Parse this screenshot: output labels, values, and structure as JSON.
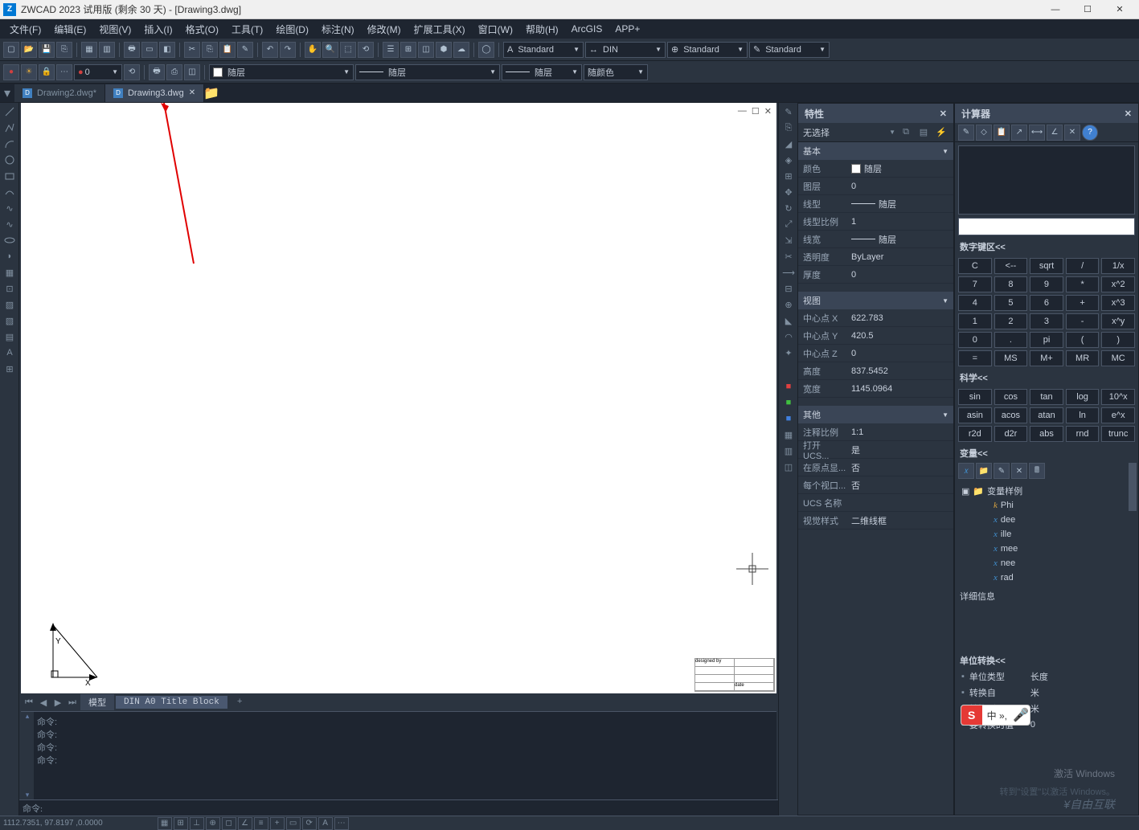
{
  "title": "ZWCAD 2023 试用版 (剩余 30 天) - [Drawing3.dwg]",
  "menus": [
    "文件(F)",
    "编辑(E)",
    "视图(V)",
    "插入(I)",
    "格式(O)",
    "工具(T)",
    "绘图(D)",
    "标注(N)",
    "修改(M)",
    "扩展工具(X)",
    "窗口(W)",
    "帮助(H)",
    "ArcGIS",
    "APP+"
  ],
  "toolbar1": {
    "layer_value": "0",
    "style_boxes": [
      {
        "icon": "A",
        "value": "Standard"
      },
      {
        "icon": "↔",
        "value": "DIN"
      },
      {
        "icon": "⊕",
        "value": "Standard"
      },
      {
        "icon": "✎",
        "value": "Standard"
      }
    ]
  },
  "toolbar2": {
    "combos": [
      "随层",
      "随层",
      "随层",
      "随颜色"
    ]
  },
  "doctabs": [
    {
      "name": "Drawing2.dwg*",
      "active": false
    },
    {
      "name": "Drawing3.dwg",
      "active": true
    }
  ],
  "layout_tabs": [
    "模型",
    "DIN A0 Title Block",
    "+"
  ],
  "command": {
    "history": [
      "命令:",
      "命令:",
      "命令:",
      "命令:"
    ],
    "prompt": "命令:"
  },
  "properties": {
    "title": "特性",
    "selector": "无选择",
    "sections": {
      "basic": {
        "title": "基本",
        "rows": [
          {
            "label": "颜色",
            "value": "随层",
            "swatch": true
          },
          {
            "label": "图层",
            "value": "0"
          },
          {
            "label": "线型",
            "value": "随层",
            "line": true
          },
          {
            "label": "线型比例",
            "value": "1"
          },
          {
            "label": "线宽",
            "value": "随层",
            "line": true
          },
          {
            "label": "透明度",
            "value": "ByLayer"
          },
          {
            "label": "厚度",
            "value": "0"
          }
        ]
      },
      "view": {
        "title": "视图",
        "rows": [
          {
            "label": "中心点 X",
            "value": "622.783"
          },
          {
            "label": "中心点 Y",
            "value": "420.5"
          },
          {
            "label": "中心点 Z",
            "value": "0"
          },
          {
            "label": "高度",
            "value": "837.5452"
          },
          {
            "label": "宽度",
            "value": "1145.0964"
          }
        ]
      },
      "other": {
        "title": "其他",
        "rows": [
          {
            "label": "注释比例",
            "value": "1:1"
          },
          {
            "label": "打开 UCS...",
            "value": "是"
          },
          {
            "label": "在原点显...",
            "value": "否"
          },
          {
            "label": "每个视口...",
            "value": "否"
          },
          {
            "label": "UCS 名称",
            "value": ""
          },
          {
            "label": "视觉样式",
            "value": "二维线框"
          }
        ]
      }
    }
  },
  "calculator": {
    "title": "计算器",
    "numpad_title": "数字键区<<",
    "numpad": [
      [
        "C",
        "<--",
        "sqrt",
        "/",
        "1/x"
      ],
      [
        "7",
        "8",
        "9",
        "*",
        "x^2"
      ],
      [
        "4",
        "5",
        "6",
        "+",
        "x^3"
      ],
      [
        "1",
        "2",
        "3",
        "-",
        "x^y"
      ],
      [
        "0",
        ".",
        "pi",
        "(",
        ")"
      ],
      [
        "=",
        "MS",
        "M+",
        "MR",
        "MC"
      ]
    ],
    "sci_title": "科学<<",
    "sci": [
      [
        "sin",
        "cos",
        "tan",
        "log",
        "10^x"
      ],
      [
        "asin",
        "acos",
        "atan",
        "ln",
        "e^x"
      ],
      [
        "r2d",
        "d2r",
        "abs",
        "rnd",
        "trunc"
      ]
    ],
    "var_title": "变量<<",
    "var_root": "变量样例",
    "vars": [
      "Phi",
      "dee",
      "ille",
      "mee",
      "nee",
      "rad"
    ],
    "detail_title": "详细信息",
    "unit_title": "单位转换<<",
    "unit_rows": [
      {
        "label": "单位类型",
        "value": "长度"
      },
      {
        "label": "转换自",
        "value": "米"
      },
      {
        "label": "转换到",
        "value": "米"
      },
      {
        "label": "要转换的值",
        "value": "0"
      }
    ]
  },
  "statusbar": {
    "coords": "1112.7351, 97.8197 ,0.0000"
  },
  "watermark": {
    "line1": "激活 Windows",
    "line2": "转到\"设置\"以激活 Windows。",
    "brand": "¥自由互联"
  },
  "ime": {
    "s": "S",
    "mid": "中 »,",
    "mic": "●"
  },
  "canvas": {
    "titleblock": {
      "r1": "designed by",
      "r2": "",
      "r3": "date"
    }
  }
}
